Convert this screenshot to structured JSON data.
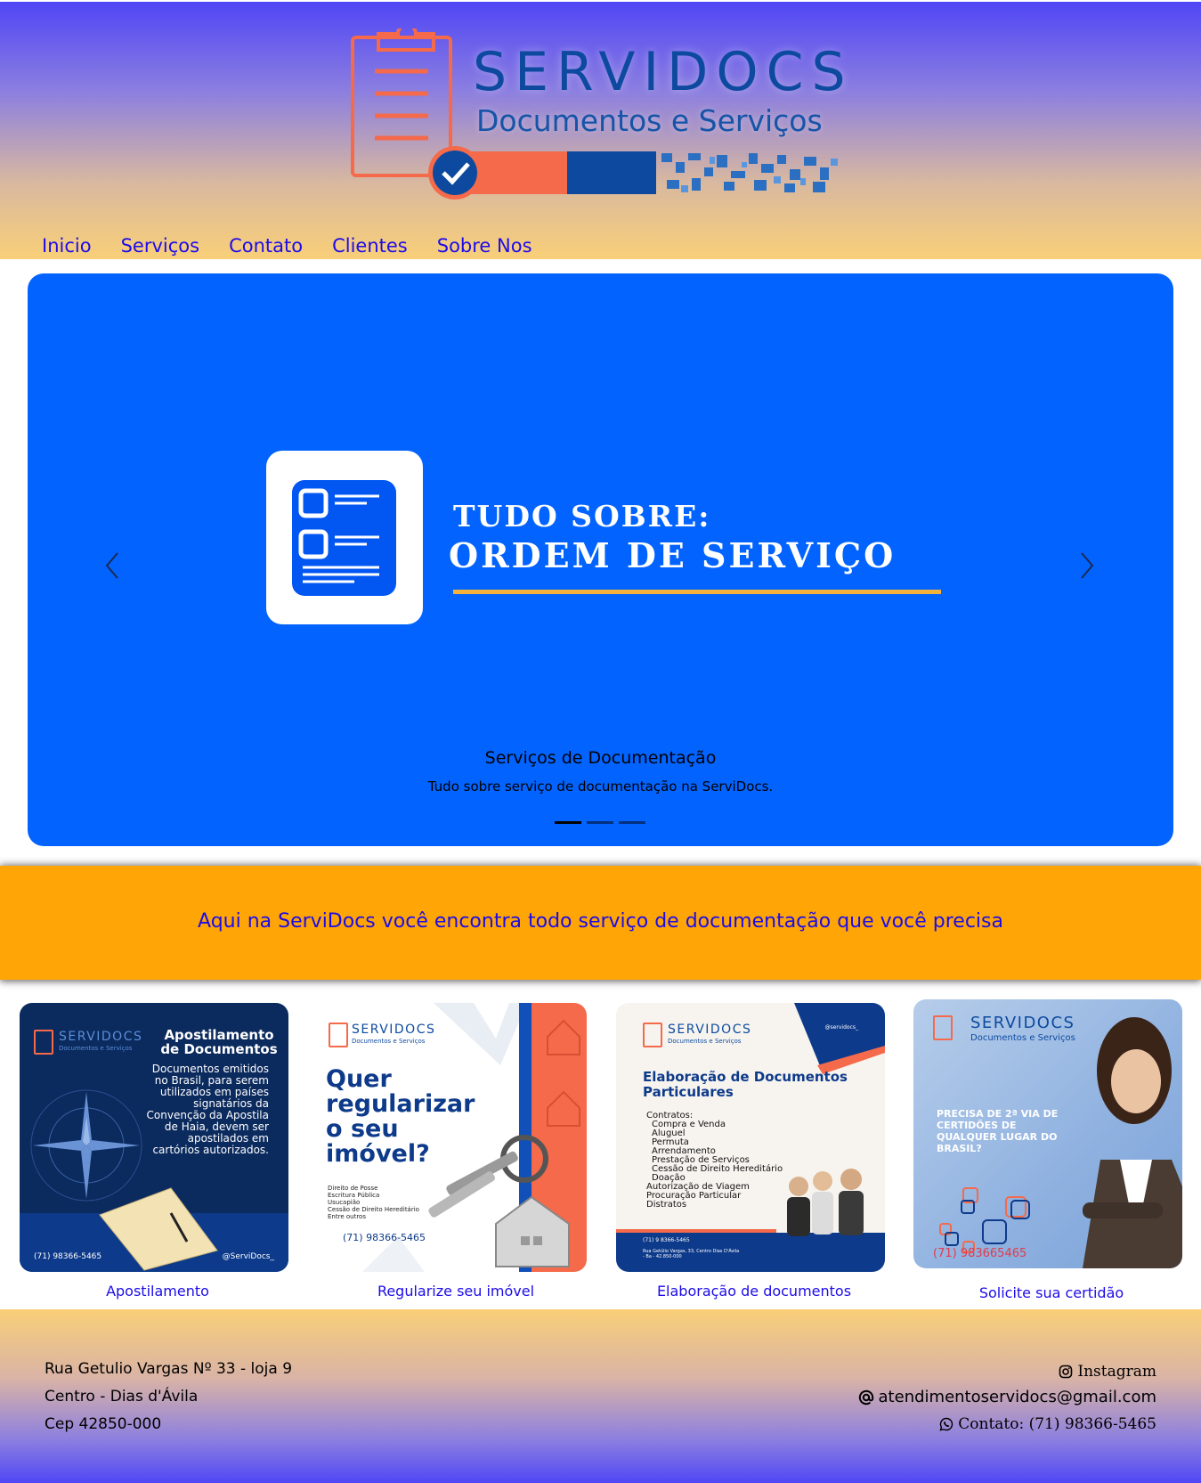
{
  "brand": {
    "name": "SERVIDOCS",
    "tagline": "Documentos e Serviços",
    "colors": {
      "primary_blue": "#0d4a9f",
      "accent_orange": "#f46a4a",
      "slide_blue": "#0263fe",
      "banner_orange": "#ffa505",
      "link_blue": "#1d0ce8"
    }
  },
  "nav": {
    "items": [
      {
        "label": "Inicio"
      },
      {
        "label": "Serviços"
      },
      {
        "label": "Contato"
      },
      {
        "label": "Clientes"
      },
      {
        "label": "Sobre Nos"
      }
    ]
  },
  "carousel": {
    "slide": {
      "heading_line1": "TUDO SOBRE:",
      "heading_line2": "ORDEM DE SERVIÇO",
      "icon": "checklist-icon"
    },
    "caption_title": "Serviços de Documentação",
    "caption_text": "Tudo sobre serviço de documentação na ServiDocs.",
    "prev_icon": "chevron-left-icon",
    "next_icon": "chevron-right-icon",
    "indicator_count": 3,
    "active_index": 0
  },
  "banner": {
    "text": "Aqui na ServiDocs você encontra todo serviço de documentação que você precisa"
  },
  "services": [
    {
      "link": "Apostilamento",
      "card": {
        "title": "Apostilamento de Documentos",
        "body": "Documentos emitidos no Brasil, para serem utilizados em países signatários da Convenção da Apostila de Haia, devem ser apostilados em cartórios autorizados.",
        "phone": "(71) 98366-5465",
        "handle": "@ServiDocs_"
      }
    },
    {
      "link": "Regularize seu imóvel",
      "card": {
        "title": "Quer regularizar o seu imóvel?",
        "items": [
          "Direito de Posse",
          "Escritura Pública",
          "Usucapião",
          "Cessão de Direito Hereditário",
          "Entre outros"
        ],
        "phone": "(71) 98366-5465"
      }
    },
    {
      "link": "Elaboração de documentos",
      "card": {
        "title": "Elaboração de Documentos Particulares",
        "handle": "@servidocs_",
        "intro": "Contratos:",
        "items": [
          "Compra e Venda",
          "Aluguel",
          "Permuta",
          "Arrendamento",
          "Prestação de Serviços",
          "Cessão de Direito Hereditário",
          "Doação"
        ],
        "extra": [
          "Autorização de Viagem",
          "Procuração Particular",
          "Distratos"
        ],
        "phone": "(71) 9 8366-5465",
        "address": "Rua Getúlio Vargas, 33, Centro Dias D'Ávila - Ba - 42.850-000"
      }
    },
    {
      "link": "Solicite sua certidão",
      "card": {
        "title": "PRECISA DE 2ª VIA DE CERTIDÕES DE QUALQUER LUGAR DO BRASIL?",
        "phone": "(71) 983665465"
      }
    }
  ],
  "footer": {
    "address_line1": "Rua Getulio Vargas Nº 33 - loja 9",
    "address_line2": "Centro - Dias d'Ávila",
    "address_line3": "Cep 42850-000",
    "instagram_label": "Instagram",
    "email": "atendimentoservidocs@gmail.com",
    "phone_label": "Contato: (71) 98366-5465",
    "icons": [
      "instagram-icon",
      "at-sign-icon",
      "whatsapp-icon"
    ]
  }
}
